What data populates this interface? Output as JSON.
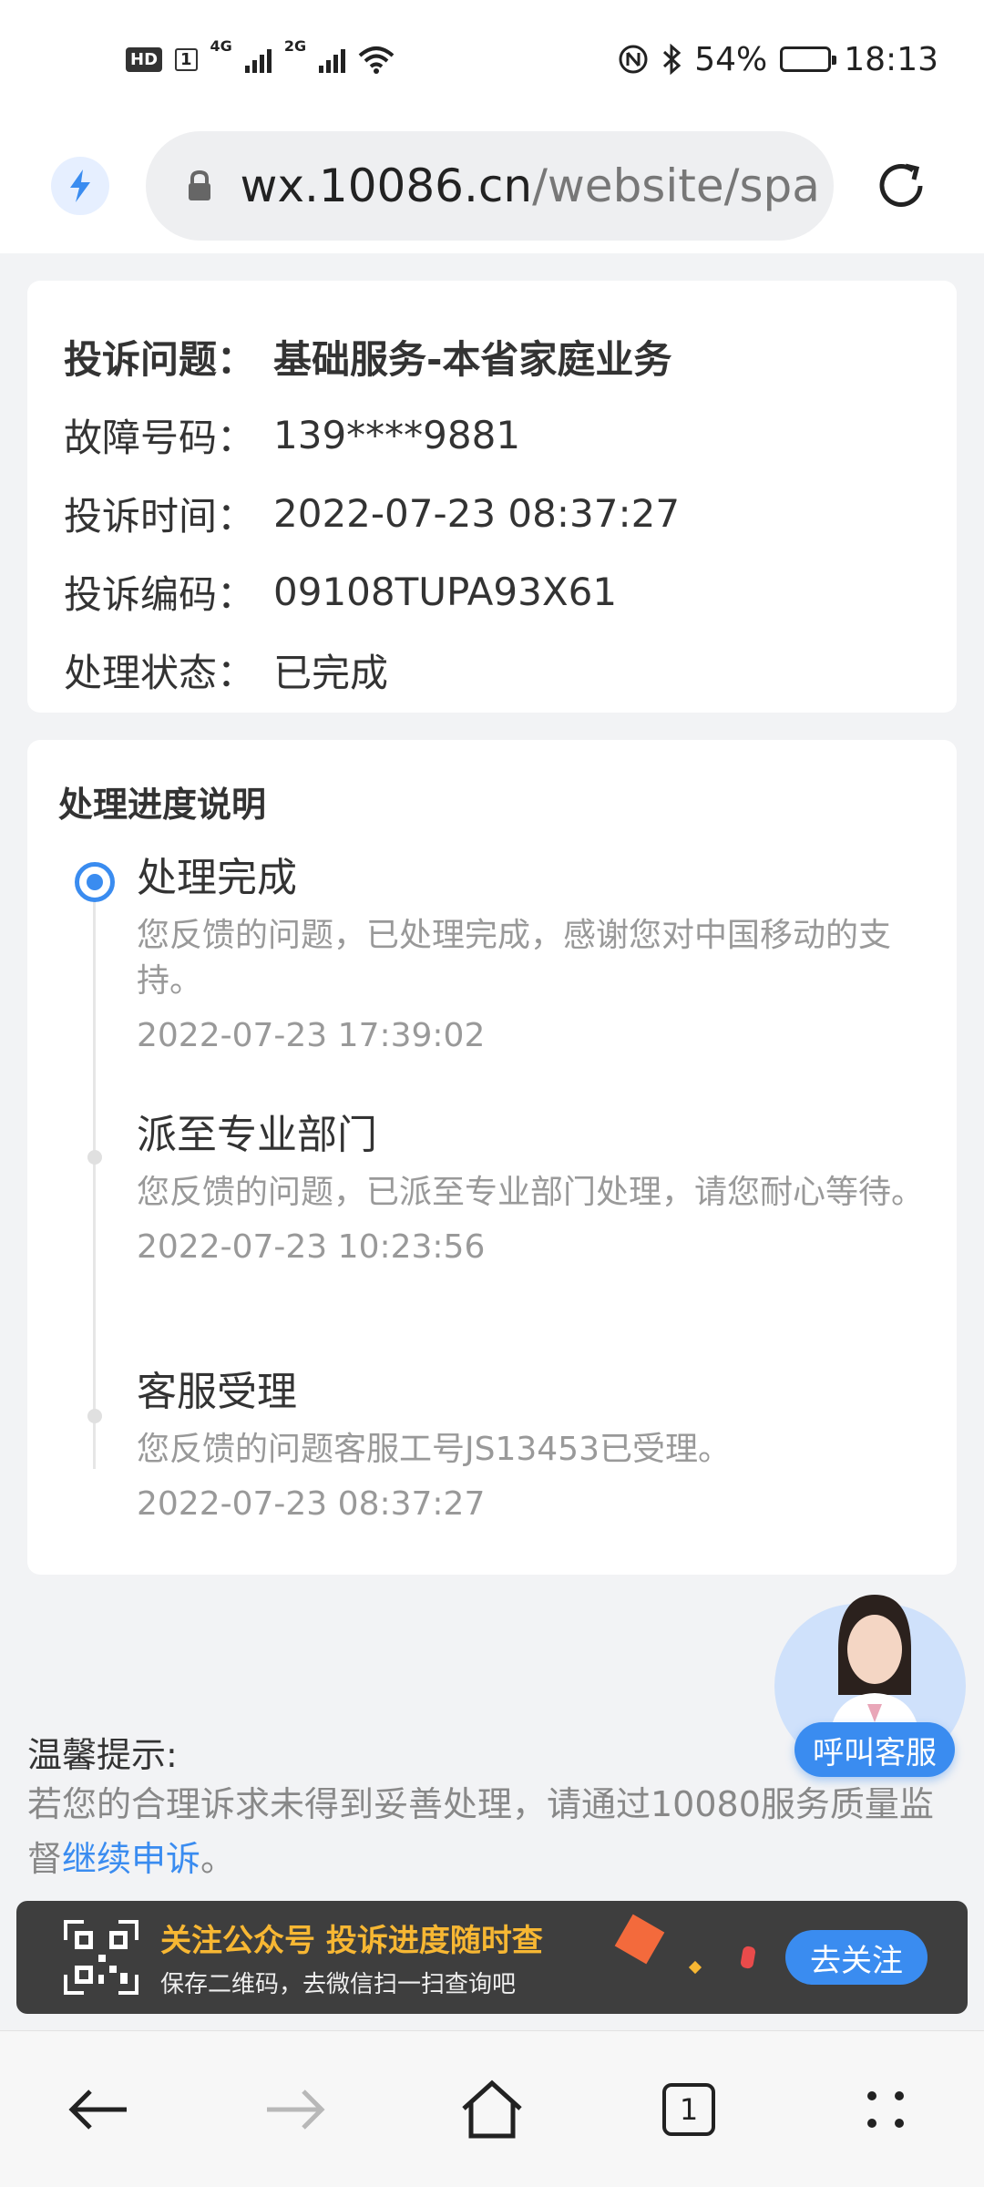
{
  "status_bar": {
    "network_4g": "4G",
    "network_2g": "2G",
    "hd": "HD",
    "sim": "1",
    "battery": "54%",
    "battery_level": 0.54,
    "time": "18:13"
  },
  "browser": {
    "url_host": "wx.10086.cn",
    "url_path": "/website/spa",
    "tab_count": "1"
  },
  "complaint": {
    "rows": [
      {
        "label": "投诉问题：",
        "value": "基础服务-本省家庭业务"
      },
      {
        "label": "故障号码：",
        "value": "139****9881"
      },
      {
        "label": "投诉时间：",
        "value": "2022-07-23 08:37:27"
      },
      {
        "label": "投诉编码：",
        "value": "09108TUPA93X61"
      },
      {
        "label": "处理状态：",
        "value": "已完成"
      }
    ]
  },
  "progress": {
    "title": "处理进度说明",
    "steps": [
      {
        "title": "处理完成",
        "desc": "您反馈的问题，已处理完成，感谢您对中国移动的支持。",
        "time": "2022-07-23 17:39:02"
      },
      {
        "title": "派至专业部门",
        "desc": "您反馈的问题，已派至专业部门处理，请您耐心等待。",
        "time": "2022-07-23 10:23:56"
      },
      {
        "title": "客服受理",
        "desc": "您反馈的问题客服工号JS13453已受理。",
        "time": "2022-07-23 08:37:27"
      }
    ]
  },
  "service_button": "呼叫客服",
  "tip": {
    "title": "温馨提示:",
    "text": "若您的合理诉求未得到妥善处理，请通过10080服务质量监督",
    "link": "继续申诉",
    "tail": "。"
  },
  "follow": {
    "title": "关注公众号 投诉进度随时查",
    "subtitle": "保存二维码，去微信扫一扫查询吧",
    "button": "去关注"
  },
  "colors": {
    "accent": "#3a8cf0",
    "banner_bg": "#3e3e3e",
    "banner_title": "#f7b733"
  }
}
